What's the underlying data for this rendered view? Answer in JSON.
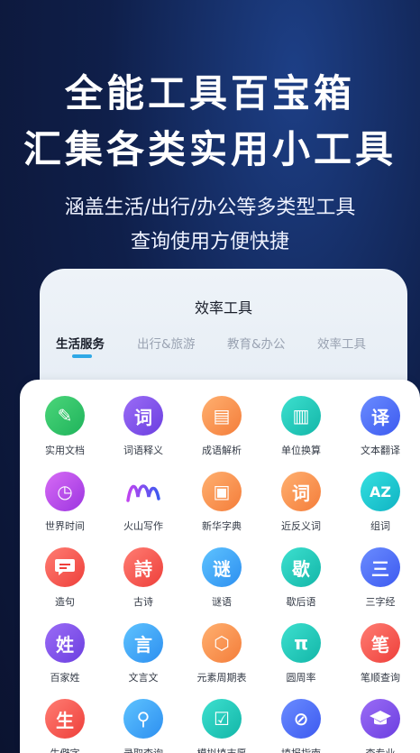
{
  "hero": {
    "title_line1": "全能工具百宝箱",
    "title_line2": "汇集各类实用小工具",
    "subtitle_line1": "涵盖生活/出行/办公等多类型工具",
    "subtitle_line2": "查询使用方便快捷"
  },
  "back_card": {
    "title": "效率工具",
    "tabs": [
      "生活服务",
      "出行&旅游",
      "教育&办公",
      "效率工具"
    ]
  },
  "tools": {
    "rows": [
      [
        {
          "label": "实用文档",
          "icon": "document-icon",
          "glyph": "✎",
          "color": "#2bbf66"
        },
        {
          "label": "词语释义",
          "icon": "ci-icon",
          "glyph": "词",
          "color": "#7a4de8"
        },
        {
          "label": "成语解析",
          "icon": "doc-clock-icon",
          "glyph": "▤",
          "color": "#f5873f"
        },
        {
          "label": "单位换算",
          "icon": "ruler-icon",
          "glyph": "▥",
          "color": "#1fc1b3"
        },
        {
          "label": "文本翻译",
          "icon": "translate-icon",
          "glyph": "译",
          "color": "#4b66f2"
        }
      ],
      [
        {
          "label": "世界时间",
          "icon": "globe-clock-icon",
          "glyph": "◷",
          "color": "#b048ea"
        },
        {
          "label": "火山写作",
          "icon": "volcano-writing-icon",
          "glyph": "ᗰ",
          "color": "#ffffff"
        },
        {
          "label": "新华字典",
          "icon": "book-icon",
          "glyph": "▣",
          "color": "#f5873f"
        },
        {
          "label": "近反义词",
          "icon": "ci-icon",
          "glyph": "词",
          "color": "#f5873f"
        },
        {
          "label": "组词",
          "icon": "az-card-icon",
          "glyph": "AZ",
          "color": "#14bfc8"
        }
      ],
      [
        {
          "label": "造句",
          "icon": "chat-bubble-icon",
          "glyph": "●",
          "color": "#f04a40"
        },
        {
          "label": "古诗",
          "icon": "shi-icon",
          "glyph": "詩",
          "color": "#f04a40"
        },
        {
          "label": "谜语",
          "icon": "mi-icon",
          "glyph": "谜",
          "color": "#3095f2"
        },
        {
          "label": "歇后语",
          "icon": "ge-icon",
          "glyph": "歇",
          "color": "#14bfc8"
        },
        {
          "label": "三字经",
          "icon": "san-icon",
          "glyph": "三",
          "color": "#4b66f2"
        }
      ],
      [
        {
          "label": "百家姓",
          "icon": "xing-icon",
          "glyph": "姓",
          "color": "#7a4de8"
        },
        {
          "label": "文言文",
          "icon": "yan-icon",
          "glyph": "言",
          "color": "#3095f2"
        },
        {
          "label": "元素周期表",
          "icon": "periodic-icon",
          "glyph": "⬡",
          "color": "#f5873f"
        },
        {
          "label": "圆周率",
          "icon": "pi-icon",
          "glyph": "π",
          "color": "#14bfc8"
        },
        {
          "label": "笔顺查询",
          "icon": "bi-icon",
          "glyph": "笔",
          "color": "#f04a40"
        }
      ],
      [
        {
          "label": "生僻字",
          "icon": "sheng-icon",
          "glyph": "生",
          "color": "#f04a40"
        },
        {
          "label": "录取查询",
          "icon": "search-person-icon",
          "glyph": "⚲",
          "color": "#3095f2"
        },
        {
          "label": "模拟填志愿",
          "icon": "checklist-icon",
          "glyph": "☑",
          "color": "#14bfc8"
        },
        {
          "label": "填报指南",
          "icon": "compass-icon",
          "glyph": "⊘",
          "color": "#4b66f2"
        },
        {
          "label": "查专业",
          "icon": "grad-cap-icon",
          "glyph": "🎓",
          "color": "#7a4de8"
        }
      ]
    ]
  }
}
